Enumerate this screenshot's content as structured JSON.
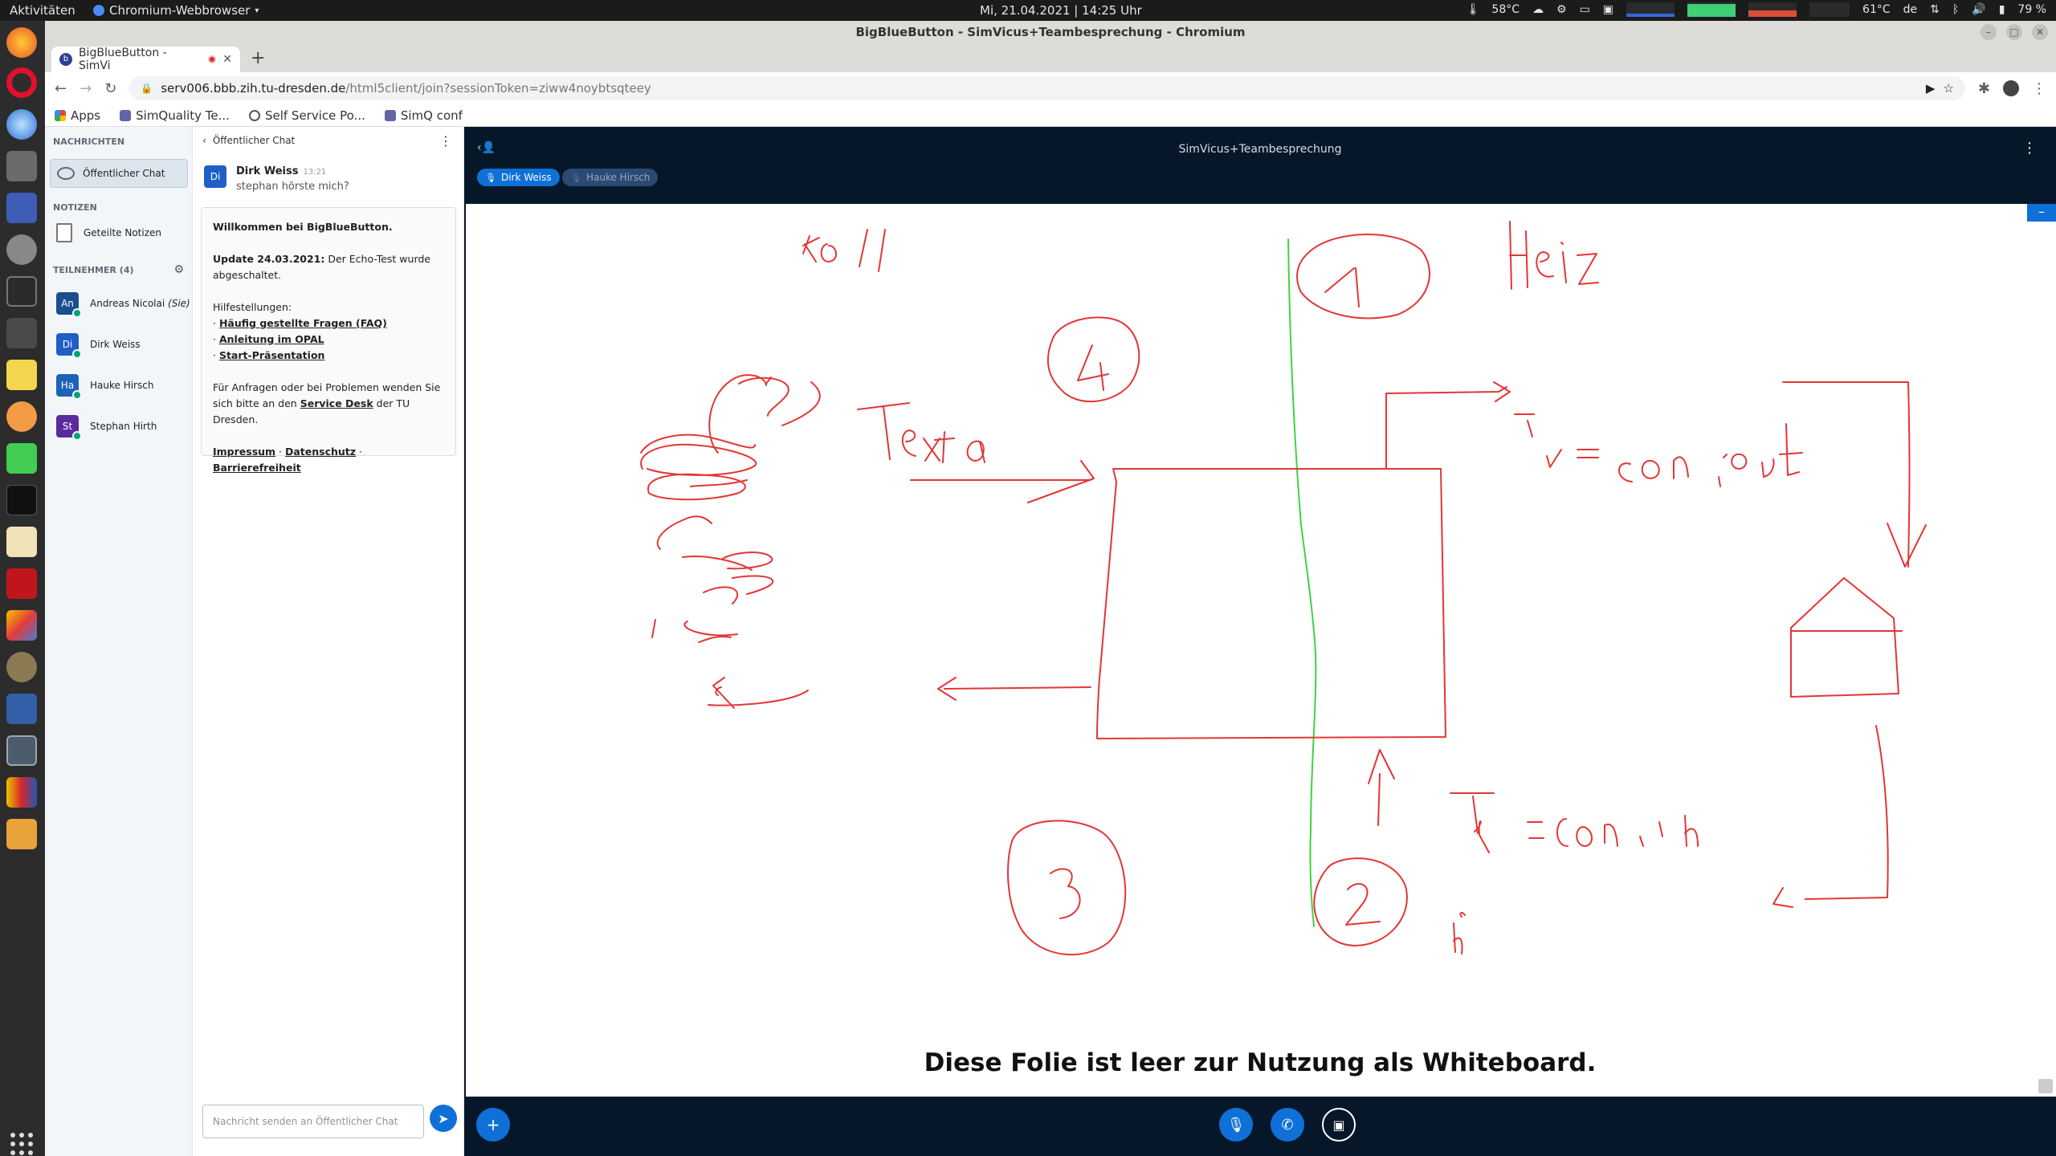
{
  "topbar": {
    "activities": "Aktivitäten",
    "app_menu": "Chromium-Webbrowser",
    "clock": "Mi, 21.04.2021 | 14:25 Uhr",
    "cpu_temp": "58°C",
    "gpu_temp": "61°C",
    "lang": "de",
    "battery": "79 %"
  },
  "browser": {
    "window_title": "BigBlueButton - SimVicus+Teambesprechung - Chromium",
    "tab_title": "BigBlueButton - SimVi",
    "url_host": "serv006.bbb.zih.tu-dresden.de",
    "url_path": "/html5client/join?sessionToken=ziww4noybtsqteey",
    "bookmarks": [
      "Apps",
      "SimQuality Te...",
      "Self Service Po...",
      "SimQ conf"
    ]
  },
  "userlist": {
    "messages_heading": "NACHRICHTEN",
    "public_chat": "Öffentlicher Chat",
    "notes_heading": "NOTIZEN",
    "shared_notes": "Geteilte Notizen",
    "participants_heading": "TEILNEHMER (4)",
    "users": [
      {
        "initials": "An",
        "name": "Andreas Nicolai",
        "suffix": "(Sie)",
        "color": "#1b4e8f"
      },
      {
        "initials": "Di",
        "name": "Dirk Weiss",
        "suffix": "",
        "color": "#1f5fc7"
      },
      {
        "initials": "Ha",
        "name": "Hauke Hirsch",
        "suffix": "",
        "color": "#1c62b8"
      },
      {
        "initials": "St",
        "name": "Stephan Hirth",
        "suffix": "",
        "color": "#5b2a9c"
      }
    ]
  },
  "chat": {
    "title": "Öffentlicher Chat",
    "message": {
      "initials": "Di",
      "author": "Dirk Weiss",
      "time": "13:21",
      "text": "stephan hörste mich?"
    },
    "welcome": {
      "title": "Willkommen bei BigBlueButton.",
      "update_bold": "Update 24.03.2021:",
      "update_text": " Der Echo-Test wurde abgeschaltet.",
      "help": "Hilfestellungen:",
      "link1": "Häufig gestellte Fragen (FAQ)",
      "link2": "Anleitung im OPAL",
      "link3": "Start-Präsentation",
      "contact1": "Für Anfragen oder bei Problemen wenden Sie sich bitte an den ",
      "service_desk": "Service Desk",
      "contact2": " der TU Dresden.",
      "impressum": "Impressum",
      "datenschutz": "Datenschutz",
      "barriere": "Barrierefreiheit"
    },
    "input_placeholder": "Nachricht senden an Öffentlicher Chat"
  },
  "presentation": {
    "meeting_title": "SimVicus+Teambesprechung",
    "talkers": [
      "Dirk Weiss",
      "Hauke Hirsch"
    ],
    "caption": "Diese Folie ist leer zur Nutzung als Whiteboard."
  }
}
